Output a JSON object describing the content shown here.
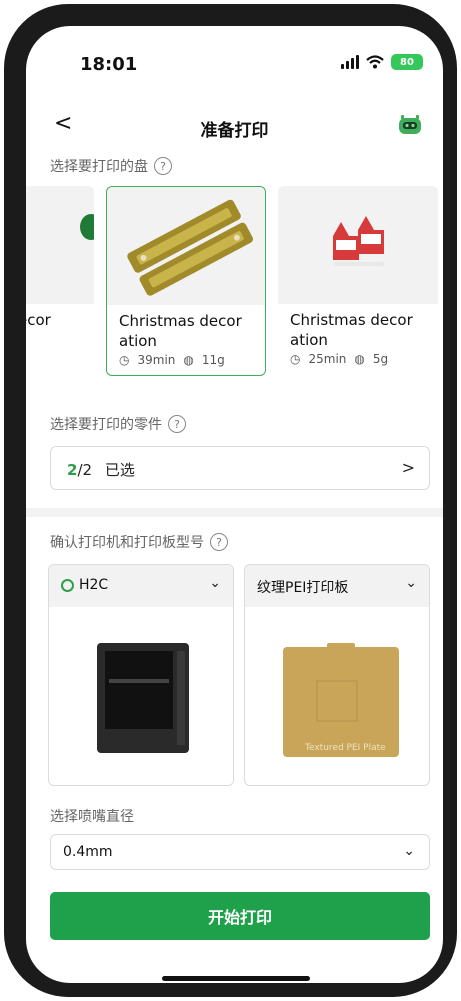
{
  "status_bar": {
    "time": "18:01",
    "battery": "80"
  },
  "header": {
    "back_label": "<",
    "title": "准备打印"
  },
  "plate_section": {
    "label": "选择要打印的盘",
    "help": "?",
    "plates": [
      {
        "name_line1": "ecor",
        "name_line2": "",
        "time": "",
        "weight": ""
      },
      {
        "name_line1": "Christmas decor",
        "name_line2": "ation",
        "time": "39min",
        "weight": "11g",
        "selected": true
      },
      {
        "name_line1": "Christmas decor",
        "name_line2": "ation",
        "time": "25min",
        "weight": "5g"
      }
    ]
  },
  "parts_section": {
    "label": "选择要打印的零件",
    "help": "?",
    "selected_count": "2",
    "total": "/2",
    "selected_label": "已选",
    "chevron": ">"
  },
  "printer_section": {
    "label": "确认打印机和打印板型号",
    "help": "?",
    "printer": {
      "name": "H2C",
      "chevron": "⌄"
    },
    "plate": {
      "name": "纹理PEI打印板",
      "chevron": "⌄",
      "plate_text": "Textured PEI Plate"
    }
  },
  "nozzle_section": {
    "label": "选择喷嘴直径",
    "value": "0.4mm",
    "chevron": "⌄"
  },
  "start_button": "开始打印",
  "colors": {
    "accent": "#1ea14a",
    "selected_border": "#3fae5a"
  }
}
